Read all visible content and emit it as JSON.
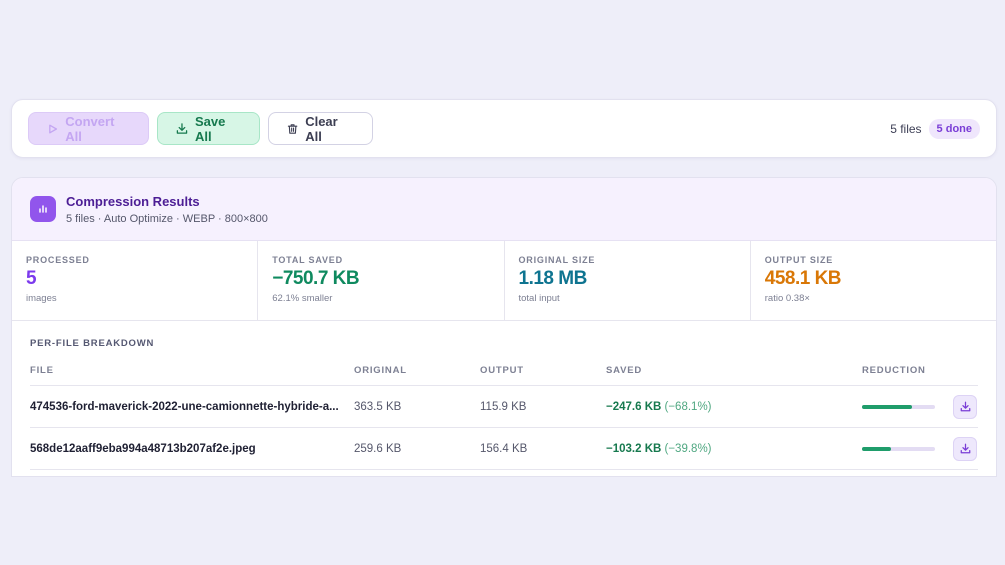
{
  "toolbar": {
    "convert_label": "Convert All",
    "save_label": "Save All",
    "clear_label": "Clear All",
    "files_count": "5 files",
    "done_badge": "5 done"
  },
  "results": {
    "title": "Compression Results",
    "subtitle": "5 files · Auto Optimize · WEBP · 800×800",
    "stats": [
      {
        "label": "PROCESSED",
        "value": "5",
        "sub": "images",
        "color": "#7c3aed"
      },
      {
        "label": "TOTAL SAVED",
        "value": "−750.7 KB",
        "sub": "62.1% smaller",
        "color": "#0f8a5f"
      },
      {
        "label": "ORIGINAL SIZE",
        "value": "1.18 MB",
        "sub": "total input",
        "color": "#0e7490"
      },
      {
        "label": "OUTPUT SIZE",
        "value": "458.1 KB",
        "sub": "ratio 0.38×",
        "color": "#d97706"
      }
    ],
    "breakdown_title": "PER-FILE BREAKDOWN",
    "columns": {
      "file": "FILE",
      "original": "ORIGINAL",
      "output": "OUTPUT",
      "saved": "SAVED",
      "reduction": "REDUCTION"
    },
    "rows": [
      {
        "file": "474536-ford-maverick-2022-une-camionnette-hybride-a...",
        "original": "363.5 KB",
        "output": "115.9 KB",
        "saved": "−247.6 KB",
        "saved_pct": "(−68.1%)",
        "reduction": 0.681
      },
      {
        "file": "568de12aaff9eba994a48713b207af2e.jpeg",
        "original": "259.6 KB",
        "output": "156.4 KB",
        "saved": "−103.2 KB",
        "saved_pct": "(−39.8%)",
        "reduction": 0.398
      }
    ]
  },
  "icons": {
    "convert": "play-icon",
    "save": "download-icon",
    "clear": "trash-icon",
    "header": "bar-chart-icon",
    "row_download": "download-icon"
  },
  "colors": {
    "accent": "#9155ec",
    "success": "#16794e",
    "background": "#eeeef9"
  }
}
